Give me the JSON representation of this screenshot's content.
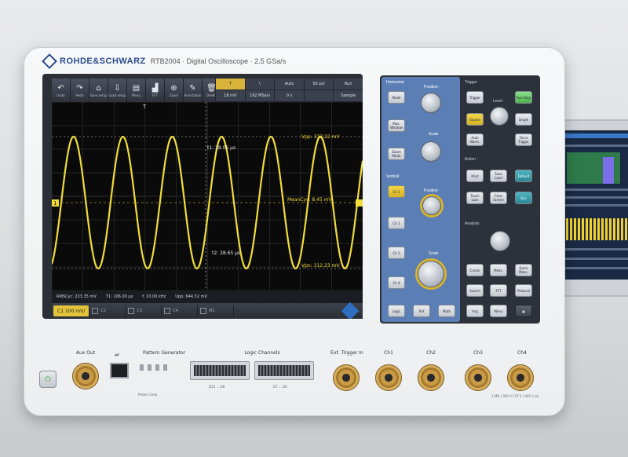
{
  "brand": {
    "name": "ROHDE&SCHWARZ",
    "model": "RTB2004 · Digital Oscilloscope · 2.5 GSa/s"
  },
  "toolbar": {
    "buttons": [
      {
        "icon": "undo-icon",
        "glyph": "↶",
        "label": "Undo"
      },
      {
        "icon": "redo-icon",
        "glyph": "↷",
        "label": "Redo"
      },
      {
        "icon": "save-recall-icon",
        "glyph": "⌂",
        "label": "Save setup"
      },
      {
        "icon": "load-setup-icon",
        "glyph": "⇩",
        "label": "Load setup"
      },
      {
        "icon": "file-icon",
        "glyph": "▤",
        "label": "Menu"
      },
      {
        "icon": "fft-icon",
        "glyph": "▟",
        "label": "FFT"
      },
      {
        "icon": "zoom-icon",
        "glyph": "⊕",
        "label": "Zoom"
      },
      {
        "icon": "annotation-icon",
        "glyph": "✎",
        "label": "Annotation"
      },
      {
        "icon": "delete-icon",
        "glyph": "🗑",
        "label": "Delete"
      }
    ],
    "info_top": [
      "T",
      "\\",
      "Auto",
      "50 ps/",
      "Run"
    ],
    "info_bottom": [
      "18 mV",
      "192 MSa/s",
      "0 s",
      "",
      "Sample"
    ]
  },
  "plot": {
    "readouts": {
      "vpp": "Vpp: 333.22 mV",
      "t1": "t1: 28.05 µs",
      "t2": "t2: 28.65 µs",
      "mean": "MeanCyc: 8.45 mV",
      "vmin": "Vpn: 312.23 mV"
    },
    "channel_marker": "1",
    "trigger_marker": "T"
  },
  "status": {
    "items": [
      "RMSCyc: 223.35 mV",
      "T1: 106.00 µs",
      "f: 10.00 kHz",
      "Upp: 644.52 mV"
    ]
  },
  "channel_bar": {
    "ch1_label": "C1",
    "ch1_value": "100 mV/",
    "slots": [
      "C2",
      "C3",
      "C4",
      "M1"
    ]
  },
  "panel": {
    "horizontal": {
      "title": "Horizontal",
      "position": "Position",
      "scale": "Scale",
      "buttons": [
        "Mode",
        "Max. Window",
        "Zoom Mode"
      ]
    },
    "vertical": {
      "title": "Vertical",
      "position": "Position",
      "scale": "Scale",
      "buttons": [
        "Ch 1",
        "Ch 2",
        "Ch 3",
        "Ch 4"
      ],
      "bottom": [
        "Logic",
        "Ref",
        "Math"
      ]
    },
    "trigger": {
      "title": "Trigger",
      "level": "Level",
      "buttons": [
        "Trigger",
        "Run Stop",
        "Source",
        "Single",
        "Auto Norm.",
        "Force Trigger"
      ]
    },
    "action": {
      "title": "Action",
      "buttons": [
        "Print",
        "Save Load",
        "Default",
        "Touch Lock",
        "Clear Screen",
        "Bus"
      ]
    },
    "analysis": {
      "title": "Analysis",
      "buttons": [
        "Cursor",
        "Meas.",
        "Quick Meas.",
        "Search",
        "FFT",
        "Protocol",
        "Acq",
        "Menu"
      ]
    }
  },
  "front": {
    "aux_out": "Aux Out",
    "pattern_generator": "Pattern Generator",
    "logic_channels": "Logic Channels",
    "logic_left": "D15 ... D8",
    "logic_right": "D7 ... D0",
    "ext_trigger": "Ext. Trigger In",
    "ch1": "Ch1",
    "ch2": "Ch2",
    "ch3": "Ch3",
    "ch4": "Ch4",
    "probe_comp": "Probe Comp",
    "rating": "1 MΩ | 300 V CAT II | 400 V pk"
  },
  "colors": {
    "trace": "#f0dc3a",
    "accent_blue": "#5b7fb5",
    "brand": "#2a4c8a"
  }
}
